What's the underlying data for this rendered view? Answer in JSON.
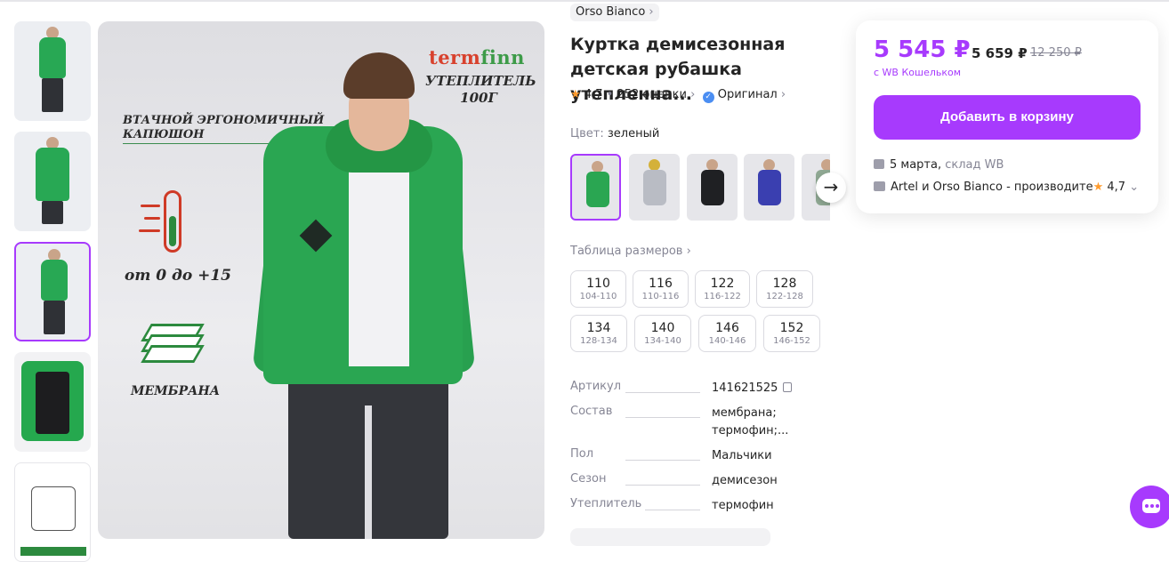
{
  "seller": {
    "name": "Orso Bianco",
    "chevron": "›"
  },
  "product": {
    "title_line1": "Куртка демисезонная",
    "title_line2": "детская рубашка утепленна...",
    "rating": "4,7",
    "reviews": "252 оценки",
    "original": "Оригинал",
    "color_label": "Цвет:",
    "color_value": "зеленый"
  },
  "gallery": {
    "brand_logo_a": "term",
    "brand_logo_b": "finn",
    "annotation_insulation": "УТЕПЛИТЕЛЬ 100Г",
    "annotation_hood_line1": "ВТАЧНОЙ ЭРГОНОМИЧНЫЙ",
    "annotation_hood_line2": "КАПЮШОН",
    "annotation_temp": "от 0 до +15",
    "annotation_membrane": "МЕМБРАНА"
  },
  "size_table_label": "Таблица размеров",
  "sizes": [
    {
      "size": "110",
      "range": "104-110"
    },
    {
      "size": "116",
      "range": "110-116"
    },
    {
      "size": "122",
      "range": "116-122"
    },
    {
      "size": "128",
      "range": "122-128"
    },
    {
      "size": "134",
      "range": "128-134"
    },
    {
      "size": "140",
      "range": "134-140"
    },
    {
      "size": "146",
      "range": "140-146"
    },
    {
      "size": "152",
      "range": "146-152"
    }
  ],
  "specs": [
    {
      "key": "Артикул",
      "value": "141621525"
    },
    {
      "key": "Состав",
      "value": "мембрана;",
      "value2": "термофин;..."
    },
    {
      "key": "Пол",
      "value": "Мальчики"
    },
    {
      "key": "Сезон",
      "value": "демисезон"
    },
    {
      "key": "Утеплитель",
      "value": "термофин"
    }
  ],
  "buy": {
    "price": "5 545 ₽",
    "price_wallet_old": "5 659 ₽",
    "price_old": "12 250 ₽",
    "wallet_note": "с WB Кошельком",
    "cart_button": "Добавить в корзину",
    "delivery_date": "5 марта,",
    "delivery_warehouse": "склад WB",
    "seller_line": "Artel и Orso Bianco - производите",
    "seller_rating": "4,7"
  },
  "colors": {
    "accent": "#a73afd",
    "green": "#2aa652",
    "star": "#ff9b2d"
  },
  "icons": [
    "star-icon",
    "verified-icon",
    "chevron-right-icon",
    "arrow-right-icon",
    "copy-icon",
    "box-icon",
    "shop-icon",
    "chat-icon"
  ]
}
